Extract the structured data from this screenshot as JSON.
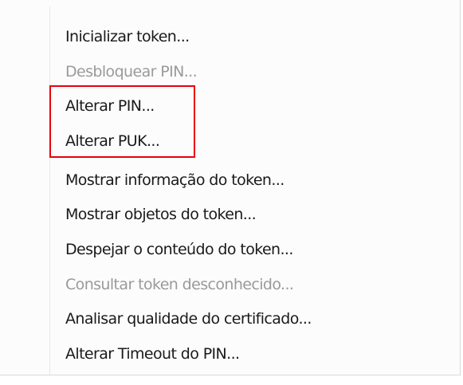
{
  "menu": {
    "items": [
      {
        "label": "Inicializar token...",
        "enabled": true
      },
      {
        "label": "Desbloquear PIN...",
        "enabled": false
      },
      {
        "label": "Alterar PIN...",
        "enabled": true
      },
      {
        "label": "Alterar PUK...",
        "enabled": true
      },
      {
        "label": "Mostrar informação do token...",
        "enabled": true
      },
      {
        "label": "Mostrar objetos do token...",
        "enabled": true
      },
      {
        "label": "Despejar o conteúdo do token...",
        "enabled": true
      },
      {
        "label": "Consultar token desconhecido...",
        "enabled": false
      },
      {
        "label": "Analisar qualidade do certificado...",
        "enabled": true
      },
      {
        "label": "Alterar Timeout do PIN...",
        "enabled": true
      }
    ]
  },
  "annotation": {
    "highlight_color": "#e8000d",
    "highlighted_items": [
      "Alterar PIN...",
      "Alterar PUK..."
    ]
  }
}
